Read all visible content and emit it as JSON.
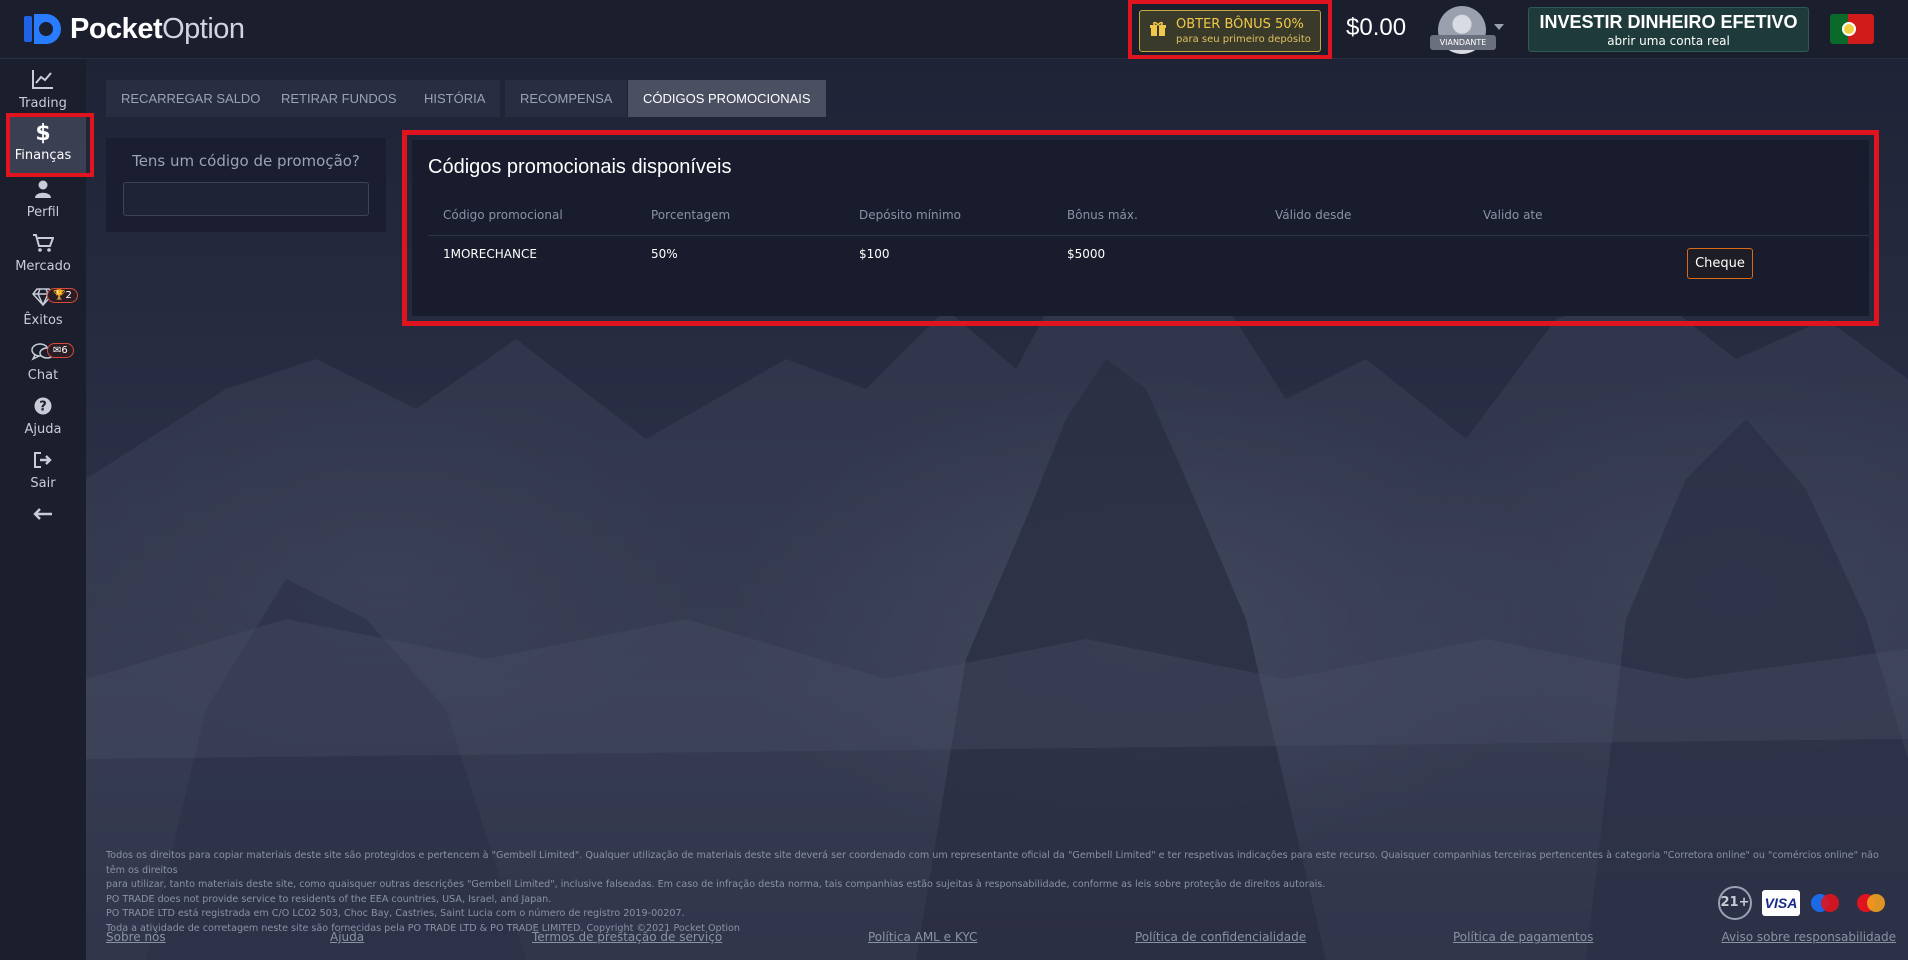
{
  "header": {
    "logo_bold": "Pocket",
    "logo_light": "Option",
    "bonus_main": "OBTER BÔNUS 50%",
    "bonus_sub": "para seu primeiro depósito",
    "balance": "$0.00",
    "avatar_badge": "VIANDANTE",
    "invest_main": "INVESTIR DINHEIRO EFETIVO",
    "invest_sub": "abrir uma conta real",
    "flag_icon": "portugal-flag-icon"
  },
  "sidebar": {
    "items": [
      {
        "label": "Trading",
        "icon": "chart-line-icon"
      },
      {
        "label": "Finanças",
        "icon": "dollar-icon"
      },
      {
        "label": "Perfil",
        "icon": "user-icon"
      },
      {
        "label": "Mercado",
        "icon": "cart-icon"
      },
      {
        "label": "Êxitos",
        "icon": "diamond-icon",
        "badge": "2"
      },
      {
        "label": "Chat",
        "icon": "chat-icon",
        "badge": "6"
      },
      {
        "label": "Ajuda",
        "icon": "help-icon"
      },
      {
        "label": "Sair",
        "icon": "logout-icon"
      }
    ],
    "collapse_icon": "arrow-left-icon"
  },
  "tabs": [
    {
      "label": "RECARREGAR SALDO"
    },
    {
      "label": "RETIRAR FUNDOS"
    },
    {
      "label": "HISTÓRIA"
    },
    {
      "label": "RECOMPENSA"
    },
    {
      "label": "CÓDIGOS PROMOCIONAIS",
      "active": true
    }
  ],
  "promo_input": {
    "question": "Tens um código de promoção?",
    "value": ""
  },
  "codes": {
    "title": "Códigos promocionais disponíveis",
    "columns": [
      "Código promocional",
      "Porcentagem",
      "Depósito mínimo",
      "Bônus máx.",
      "Válido desde",
      "Valido ate"
    ],
    "rows": [
      {
        "code": "1MORECHANCE",
        "percent": "50%",
        "min_deposit": "$100",
        "max_bonus": "$5000",
        "from": "",
        "to": "",
        "action": "Cheque"
      }
    ]
  },
  "footer": {
    "legal": [
      "Todos os direitos para copiar materiais deste site são protegidos e pertencem à \"Gembell Limited\". Qualquer utilização de materiais deste site deverá ser coordenado com um representante oficial da \"Gembell Limited\" e ter respetivas indicações para este recurso. Quaisquer companhias terceiras pertencentes à categoria \"Corretora online\" ou \"comércios online\" não têm os direitos",
      "para utilizar, tanto materiais deste site, como quaisquer outras descrições \"Gembell Limited\", inclusive falseadas. Em caso de infração desta norma, tais companhias estão sujeitas à responsabilidade, conforme as leis sobre proteção de direitos autorais.",
      "PO TRADE does not provide service to residents of the EEA countries, USA, Israel, and Japan.",
      "PO TRADE LTD está registrada em C/O LC02 503, Choc Bay, Castries, Saint Lucia com o número de registro 2019-00207.",
      "Toda a atividade de corretagem neste site são fornecidas pela PO TRADE LTD & PO TRADE LIMITED. Copyright ©2021 Pocket Option"
    ],
    "links": [
      "Sobre nós",
      "Ajuda",
      "Termos de prestação de serviço",
      "Política AML e KYC",
      "Política de confidencialidade",
      "Política de pagamentos",
      "Aviso sobre responsabilidade"
    ],
    "age": "21+",
    "visa": "VISA"
  }
}
